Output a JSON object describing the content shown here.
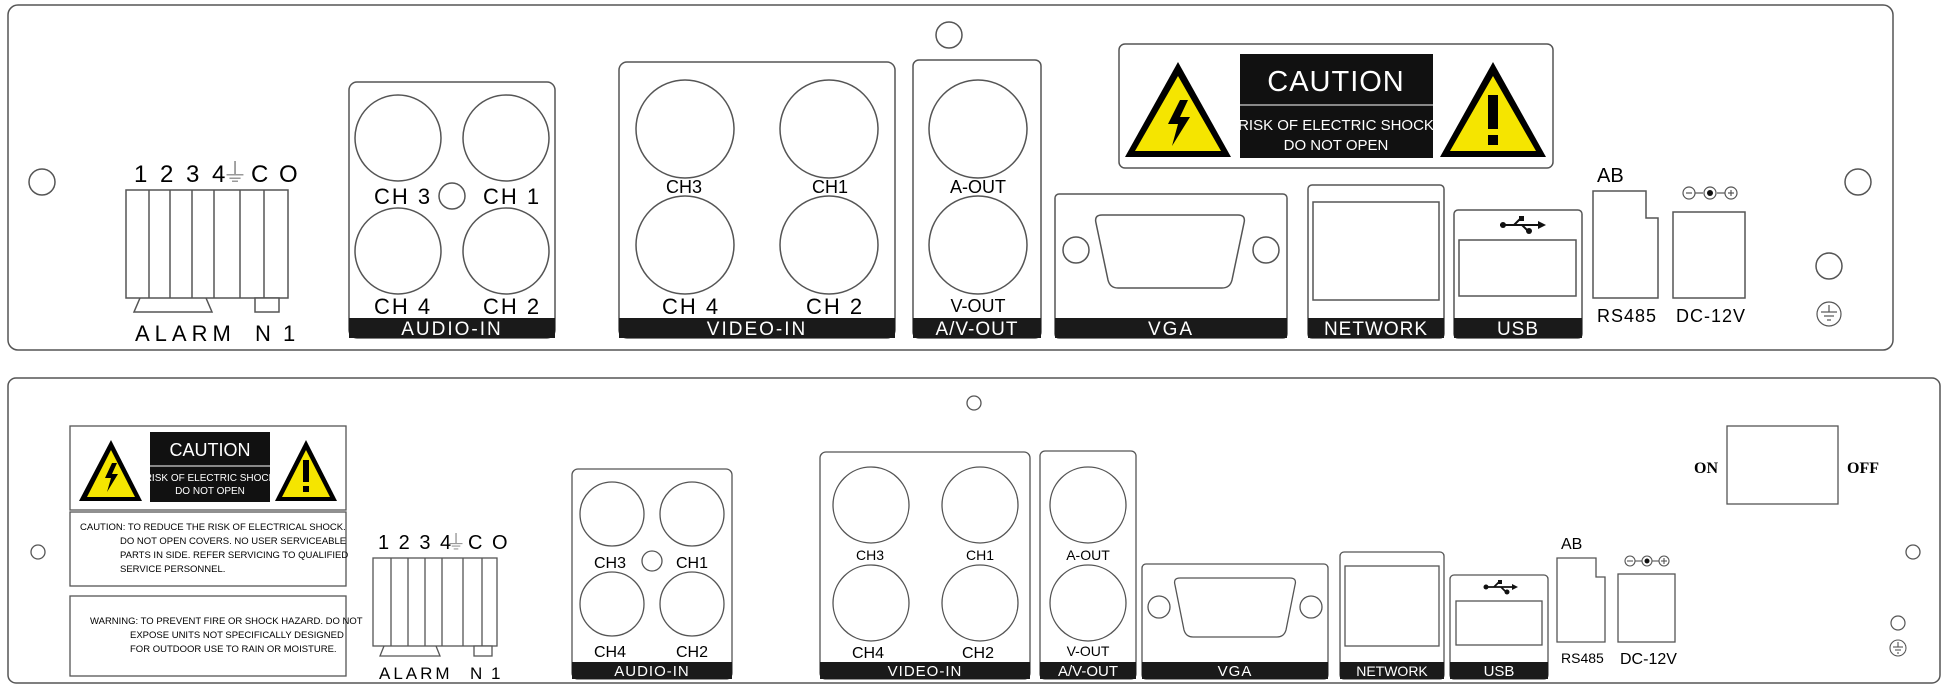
{
  "panel_top": {
    "alarm": {
      "pins": "1 2 3 4",
      "ground_symbol": "⏚",
      "co": "C O",
      "label": "ALARM",
      "n1": "N 1"
    },
    "audio_in": {
      "label": "AUDIO-IN",
      "ch1": "CH 1",
      "ch2": "CH 2",
      "ch3": "CH 3",
      "ch4": "CH 4"
    },
    "video_in": {
      "label": "VIDEO-IN",
      "ch1": "CH1",
      "ch2": "CH 2",
      "ch3": "CH3",
      "ch4": "CH 4"
    },
    "av_out": {
      "label": "A/V-OUT",
      "a_out": "A-OUT",
      "v_out": "V-OUT"
    },
    "caution": {
      "title": "CAUTION",
      "line1": "RISK  OF  ELECTRIC SHOCK",
      "line2": "DO  NOT  OPEN"
    },
    "vga": {
      "label": "VGA"
    },
    "network": {
      "label": "NETWORK"
    },
    "usb": {
      "label": "USB"
    },
    "rs485": {
      "ab": "AB",
      "label": "RS485"
    },
    "dc": {
      "label": "DC-12V"
    }
  },
  "panel_bottom": {
    "caution": {
      "title": "CAUTION",
      "line1": "RISK OF ELECTRIC SHOCK",
      "line2": "DO NOT OPEN"
    },
    "notice_caution": [
      "CAUTION: TO  REDUCE  THE  RISK  OF  ELECTRICAL  SHOCK.",
      "DO  NOT  OPEN  COVERS.  NO  USER  SERVICEABLE",
      "PARTS IN SIDE. REFER SERVICING TO QUALIFIED",
      "SERVICE  PERSONNEL."
    ],
    "notice_warning": [
      "WARNING: TO  PREVENT  FIRE  OR  SHOCK  HAZARD. DO  NOT",
      "EXPOSE  UNITS  NOT  SPECIFICALLY  DESIGNED",
      "FOR  OUTDOOR  USE  TO  RAIN  OR  MOISTURE."
    ],
    "alarm": {
      "pins": "1 2 3 4",
      "ground_symbol": "⏚",
      "co": "C O",
      "label": "ALARM",
      "n1": "N 1"
    },
    "audio_in": {
      "label": "AUDIO-IN",
      "ch1": "CH1",
      "ch2": "CH2",
      "ch3": "CH3",
      "ch4": "CH4"
    },
    "video_in": {
      "label": "VIDEO-IN",
      "ch1": "CH1",
      "ch2": "CH2",
      "ch3": "CH3",
      "ch4": "CH4"
    },
    "av_out": {
      "label": "A/V-OUT",
      "a_out": "A-OUT",
      "v_out": "V-OUT"
    },
    "vga": {
      "label": "VGA"
    },
    "network": {
      "label": "NETWORK"
    },
    "usb": {
      "label": "USB"
    },
    "rs485": {
      "ab": "AB",
      "label": "RS485"
    },
    "dc": {
      "label": "DC-12V"
    },
    "power_switch": {
      "on": "ON",
      "off": "OFF"
    }
  }
}
